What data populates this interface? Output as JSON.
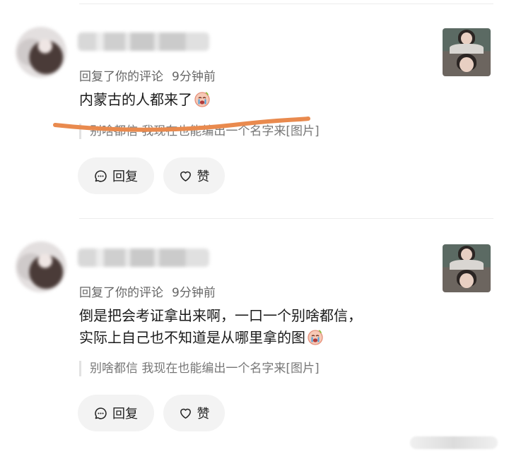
{
  "comments": [
    {
      "meta_action": "回复了你的评论",
      "meta_time": "9分钟前",
      "text_line1": "内蒙古的人都来了",
      "text_line2": "",
      "emoji_icon": "crying-face-emoji",
      "quote": "别啥都信 我现在也能编出一个名字来[图片]",
      "reply_label": "回复",
      "like_label": "赞"
    },
    {
      "meta_action": "回复了你的评论",
      "meta_time": "9分钟前",
      "text_line1": "倒是把会考证拿出来啊，一口一个别啥都信，",
      "text_line2": "实际上自己也不知道是从哪里拿的图",
      "emoji_icon": "crying-face-emoji",
      "quote": "别啥都信 我现在也能编出一个名字来[图片]",
      "reply_label": "回复",
      "like_label": "赞"
    }
  ],
  "colors": {
    "annotation_stroke": "#e98a4e",
    "pill_background": "#f3f3f3",
    "meta_text": "#666666"
  }
}
